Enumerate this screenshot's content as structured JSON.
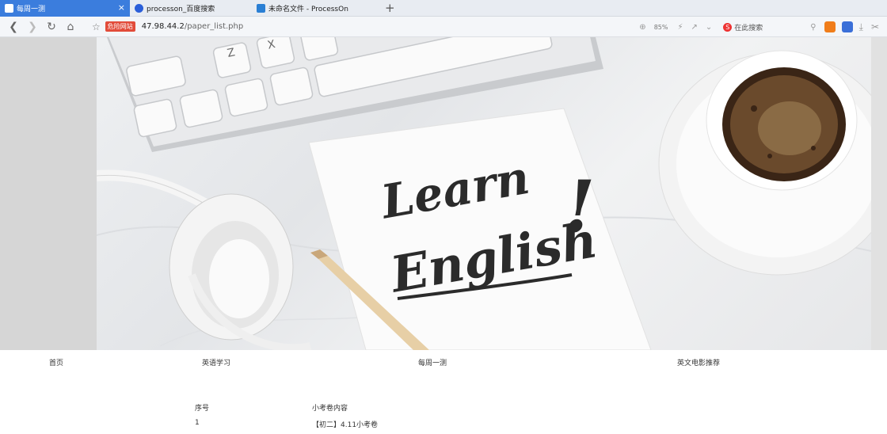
{
  "browser": {
    "tabs": [
      {
        "label": "每周一测",
        "close": "×"
      },
      {
        "label": "processon_百度搜索"
      },
      {
        "label": "未命名文件 - ProcessOn"
      }
    ],
    "new_tab": "+",
    "warning_badge": "危险网站",
    "url_host": "47.98.44.2",
    "url_path": "/paper_list.php",
    "zoom": "85%",
    "search_label": "在此搜索"
  },
  "banner": {
    "line1": "Learn",
    "line2": "English",
    "bang": "!"
  },
  "nav": {
    "home": "首页",
    "english": "英语学习",
    "weekly": "每周一测",
    "movies": "英文电影推荐"
  },
  "table": {
    "headers": [
      "序号",
      "小考卷内容"
    ],
    "rows": [
      {
        "index": "1",
        "content": "【初二】4.11小考卷"
      }
    ]
  },
  "colors": {
    "accent": "#3b7ddd",
    "warning": "#e24c3a"
  }
}
